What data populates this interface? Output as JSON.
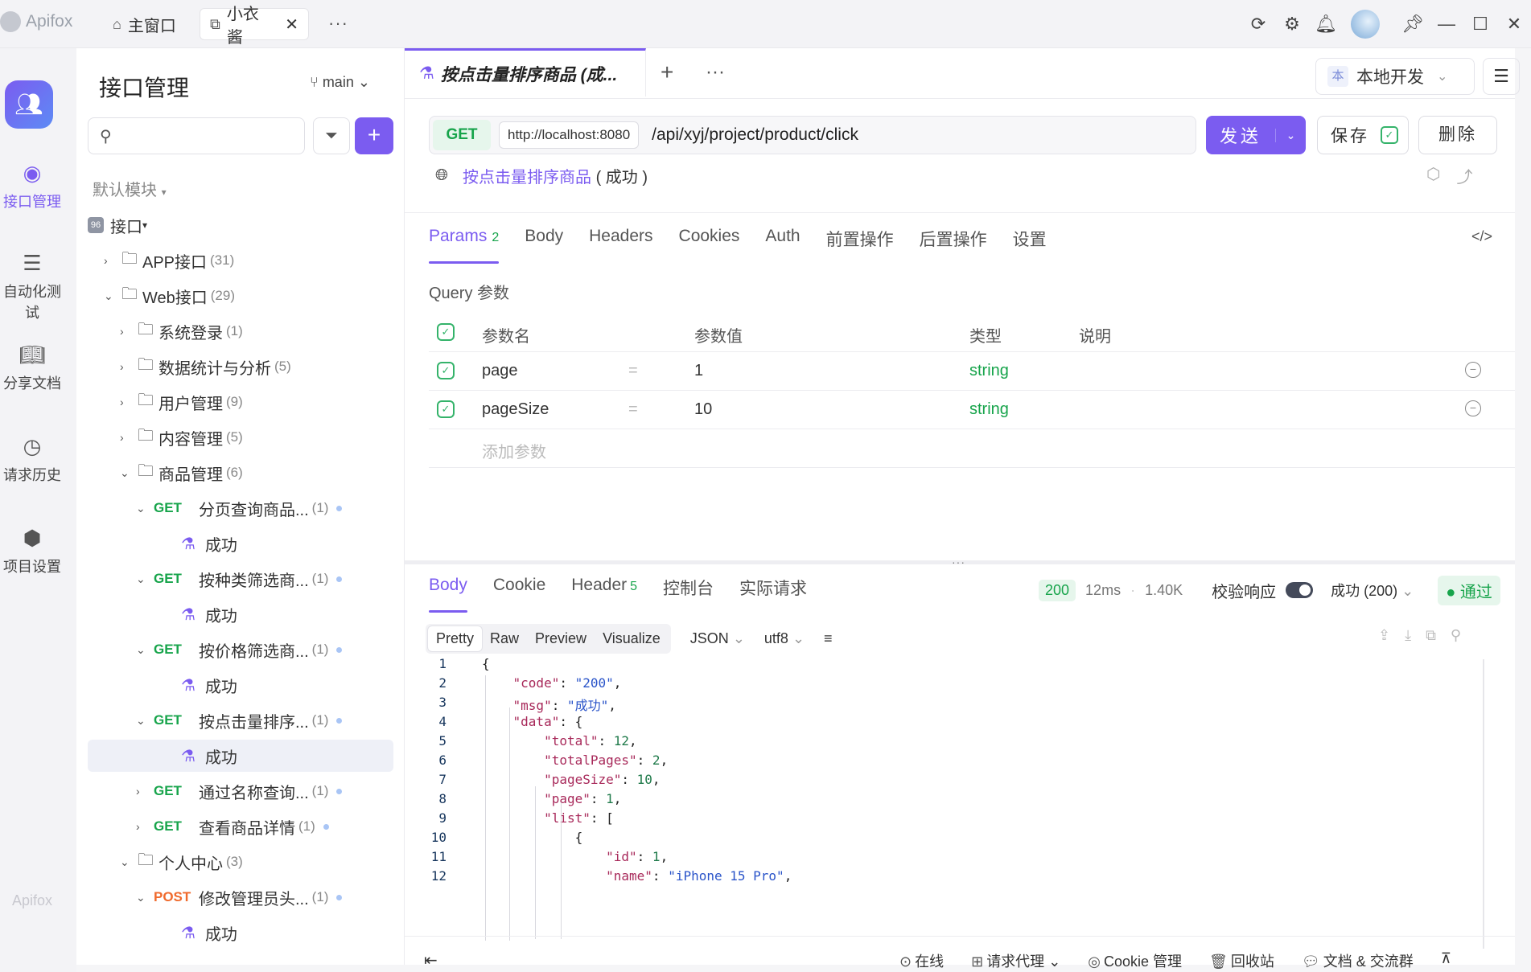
{
  "titlebar": {
    "app_name": "Apifox",
    "tabs": [
      {
        "label": "主窗口",
        "icon": "home-icon"
      },
      {
        "label": "小衣酱",
        "icon": "external-link-icon",
        "close": "✕"
      }
    ],
    "more": "···"
  },
  "rail": {
    "items": [
      {
        "label": "接口管理",
        "icon": "api-icon"
      },
      {
        "label": "自动化测试",
        "icon": "automation-icon"
      },
      {
        "label": "分享文档",
        "icon": "book-icon"
      },
      {
        "label": "请求历史",
        "icon": "clock-icon"
      },
      {
        "label": "项目设置",
        "icon": "settings-icon"
      }
    ],
    "footer": "Apifox"
  },
  "sidebar": {
    "title": "接口管理",
    "branch": "main",
    "module": "默认模块",
    "tree": [
      {
        "kind": "root",
        "label": "接口",
        "indent": 0
      },
      {
        "kind": "folder",
        "label": "APP接口",
        "count": "(31)",
        "arrow": "›",
        "indent": 1
      },
      {
        "kind": "folder",
        "label": "Web接口",
        "count": "(29)",
        "arrow": "⌄",
        "indent": 1
      },
      {
        "kind": "folder",
        "label": "系统登录",
        "count": "(1)",
        "arrow": "›",
        "indent": 2
      },
      {
        "kind": "folder",
        "label": "数据统计与分析",
        "count": "(5)",
        "arrow": "›",
        "indent": 2
      },
      {
        "kind": "folder",
        "label": "用户管理",
        "count": "(9)",
        "arrow": "›",
        "indent": 2
      },
      {
        "kind": "folder",
        "label": "内容管理",
        "count": "(5)",
        "arrow": "›",
        "indent": 2
      },
      {
        "kind": "folder",
        "label": "商品管理",
        "count": "(6)",
        "arrow": "⌄",
        "indent": 2
      },
      {
        "kind": "api",
        "method": "GET",
        "label": "分页查询商品...",
        "count": "(1)",
        "arrow": "⌄",
        "indent": 3
      },
      {
        "kind": "case",
        "label": "成功",
        "indent": 4
      },
      {
        "kind": "api",
        "method": "GET",
        "label": "按种类筛选商...",
        "count": "(1)",
        "arrow": "⌄",
        "indent": 3
      },
      {
        "kind": "case",
        "label": "成功",
        "indent": 4
      },
      {
        "kind": "api",
        "method": "GET",
        "label": "按价格筛选商...",
        "count": "(1)",
        "arrow": "⌄",
        "indent": 3
      },
      {
        "kind": "case",
        "label": "成功",
        "indent": 4
      },
      {
        "kind": "api",
        "method": "GET",
        "label": "按点击量排序...",
        "count": "(1)",
        "arrow": "⌄",
        "indent": 3
      },
      {
        "kind": "case",
        "label": "成功",
        "indent": 4,
        "selected": true
      },
      {
        "kind": "api",
        "method": "GET",
        "label": "通过名称查询...",
        "count": "(1)",
        "arrow": "›",
        "indent": 3
      },
      {
        "kind": "api",
        "method": "GET",
        "label": "查看商品详情",
        "count": "(1)",
        "arrow": "›",
        "indent": 3
      },
      {
        "kind": "folder",
        "label": "个人中心",
        "count": "(3)",
        "arrow": "⌄",
        "indent": 2
      },
      {
        "kind": "api",
        "method": "POST",
        "label": "修改管理员头...",
        "count": "(1)",
        "arrow": "⌄",
        "indent": 3
      },
      {
        "kind": "case",
        "label": "成功",
        "indent": 4
      }
    ]
  },
  "main": {
    "doc_tab": "按点击量排序商品 (成...",
    "env": {
      "badge": "本",
      "label": "本地开发"
    },
    "request": {
      "method": "GET",
      "host": "http://localhost:8080",
      "path": "/api/xyj/project/product/click",
      "send": "发送",
      "save": "保存",
      "delete": "删除",
      "name": "按点击量排序商品",
      "status": "( 成功 )"
    },
    "req_tabs": [
      {
        "label": "Params",
        "num": "2",
        "on": true
      },
      {
        "label": "Body"
      },
      {
        "label": "Headers"
      },
      {
        "label": "Cookies"
      },
      {
        "label": "Auth"
      },
      {
        "label": "前置操作"
      },
      {
        "label": "后置操作"
      },
      {
        "label": "设置"
      }
    ],
    "query_title": "Query 参数",
    "param_headers": {
      "name": "参数名",
      "value": "参数值",
      "type": "类型",
      "desc": "说明"
    },
    "params": [
      {
        "name": "page",
        "eq": "=",
        "value": "1",
        "type": "string"
      },
      {
        "name": "pageSize",
        "eq": "=",
        "value": "10",
        "type": "string"
      }
    ],
    "add_param": "添加参数",
    "res_tabs": [
      {
        "label": "Body",
        "on": true
      },
      {
        "label": "Cookie"
      },
      {
        "label": "Header",
        "num": "5"
      },
      {
        "label": "控制台"
      },
      {
        "label": "实际请求"
      }
    ],
    "res_meta": {
      "code": "200",
      "time": "12ms",
      "size": "1.40K",
      "validate_label": "校验响应",
      "validate_select": "成功 (200)",
      "pass": "通过"
    },
    "formats": [
      "Pretty",
      "Raw",
      "Preview",
      "Visualize"
    ],
    "format_type": "JSON",
    "encoding": "utf8",
    "code_lines": [
      {
        "n": "1",
        "html": "{"
      },
      {
        "n": "2",
        "html": "    <span class=\"k\">\"code\"</span>: <span class=\"s\">\"200\"</span>,"
      },
      {
        "n": "3",
        "html": "    <span class=\"k\">\"msg\"</span>: <span class=\"s\">\"成功\"</span>,"
      },
      {
        "n": "4",
        "html": "    <span class=\"k\">\"data\"</span>: {"
      },
      {
        "n": "5",
        "html": "        <span class=\"k\">\"total\"</span>: <span class=\"n\">12</span>,"
      },
      {
        "n": "6",
        "html": "        <span class=\"k\">\"totalPages\"</span>: <span class=\"n\">2</span>,"
      },
      {
        "n": "7",
        "html": "        <span class=\"k\">\"pageSize\"</span>: <span class=\"n\">10</span>,"
      },
      {
        "n": "8",
        "html": "        <span class=\"k\">\"page\"</span>: <span class=\"n\">1</span>,"
      },
      {
        "n": "9",
        "html": "        <span class=\"k\">\"list\"</span>: ["
      },
      {
        "n": "10",
        "html": "            {"
      },
      {
        "n": "11",
        "html": "                <span class=\"k\">\"id\"</span>: <span class=\"n\">1</span>,"
      },
      {
        "n": "12",
        "html": "                <span class=\"k\">\"name\"</span>: <span class=\"s\">\"iPhone 15 Pro\"</span>,"
      }
    ],
    "statusbar": [
      {
        "label": "在线",
        "icon": "check-circle-icon"
      },
      {
        "label": "请求代理 ⌄",
        "icon": "proxy-icon"
      },
      {
        "label": "Cookie 管理",
        "icon": "cookie-icon"
      },
      {
        "label": "回收站",
        "icon": "trash-icon"
      },
      {
        "label": "文档 & 交流群",
        "icon": "chat-icon"
      }
    ]
  },
  "colors": {
    "accent": "#7b5cf0",
    "get": "#17a44b",
    "post": "#f06a2c"
  }
}
